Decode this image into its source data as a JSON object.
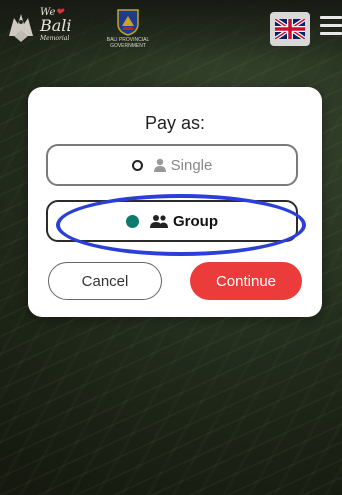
{
  "header": {
    "logo": {
      "line1": "We",
      "line2": "Bali",
      "line3": "Memorial"
    },
    "government": {
      "line1": "BALI PROVINCIAL",
      "line2": "GOVERNMENT"
    },
    "language_flag": "uk-flag-icon",
    "menu_icon": "hamburger-menu-icon"
  },
  "modal": {
    "title": "Pay as:",
    "options": [
      {
        "label": "Single",
        "icon": "person-icon",
        "selected": false
      },
      {
        "label": "Group",
        "icon": "group-icon",
        "selected": true
      }
    ],
    "cancel_label": "Cancel",
    "continue_label": "Continue"
  },
  "colors": {
    "accent": "#ec3b3b",
    "selected_radio": "#0e7a6e",
    "annotation": "#2a3fd8"
  }
}
